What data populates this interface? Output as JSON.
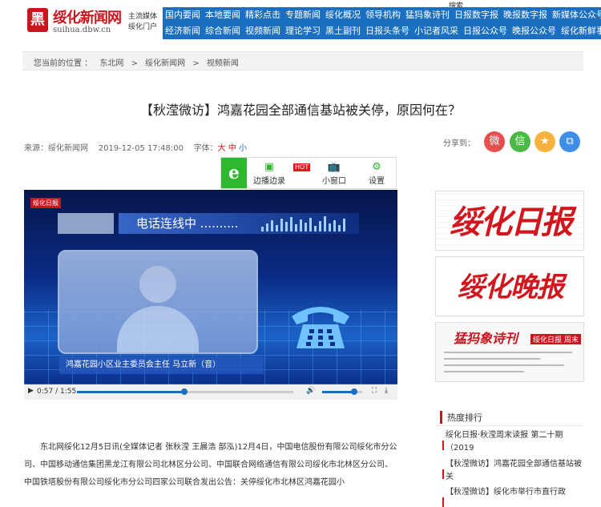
{
  "header": {
    "logo_mark": "黑",
    "site_name": "绥化新闻网",
    "domain": "suihua.dbw.cn",
    "slogan_line1": "主流媒体",
    "slogan_line2": "绥化门户",
    "search_label": "搜索",
    "nav_row1": [
      "国内要闻",
      "本地要闻",
      "精彩点击",
      "专题新闻",
      "绥化概况",
      "领导机构",
      "猛犸象诗刊",
      "日报数字报",
      "晚报数字报",
      "新媒体公众号"
    ],
    "nav_row2": [
      "经济新闻",
      "综合新闻",
      "视频新闻",
      "理论学习",
      "黑土副刊",
      "日报头条号",
      "小记者风采",
      "日报公众号",
      "晚报公众号",
      "绥化新鲜事儿"
    ]
  },
  "breadcrumb": {
    "prefix": "您当前的位置 ：",
    "items": [
      "东北网",
      ">",
      "绥化新闻网",
      ">",
      "视频新闻"
    ]
  },
  "article": {
    "title": "【秋滢微访】鸿嘉花园全部通信基站被关停，原因何在？",
    "source": "来源：绥化新闻网",
    "datetime": "2019-12-05 17:48:00",
    "font_label": "字体：",
    "font_large": "大",
    "font_medium": "中",
    "font_small": "小",
    "share_label": "分享到：",
    "body": "东北网绥化12月5日讯(全媒体记者 张秋滢 王晨浩 部泓)12月4日，中国电信股份有限公司绥化市分公司、中国移动通信集团黑龙江有限公司北林区分公司、中国联合网络通信有限公司绥化市北林区分公司、中国铁塔股份有限公司绥化市分公司四家公司联合发出公告：关停绥化市北林区鸿嘉花园小"
  },
  "share_icons": [
    {
      "name": "weibo-icon",
      "glyph": "微",
      "color": "#e5504f"
    },
    {
      "name": "wechat-icon",
      "glyph": "信",
      "color": "#4cb848"
    },
    {
      "name": "qzone-icon",
      "glyph": "★",
      "color": "#f6b13e"
    },
    {
      "name": "copy-icon",
      "glyph": "⧉",
      "color": "#3e8ee8"
    }
  ],
  "player_toolbar": {
    "logo": "e",
    "edge_play": "边播边录",
    "hot_badge": "HOT",
    "mini_window": "小窗口",
    "settings": "设置"
  },
  "video": {
    "watermark": "绥化日报",
    "call_text": "电话连线中 ..........",
    "caption": "鸿嘉花园小区业主委员会主任    马立新（音）",
    "current_time": "0:57",
    "total_time": "1:55",
    "time_display": "0:57 / 1:55",
    "progress_fraction": 0.4957,
    "volume_fraction": 0.8
  },
  "sidebar": {
    "ad1_text": "绥化日报",
    "ad2_text": "绥化晚报",
    "ad3_text": "猛犸象诗刊",
    "ad3_sub": "绥化日报 周末",
    "hot_header": "热度排行",
    "hot_items": [
      "绥化日报·秋滢周末读报 第二十期（2019",
      "【秋滢微访】鸿嘉花园全部通信基站被关",
      "【秋滢微访】绥化市举行市直行政"
    ]
  }
}
